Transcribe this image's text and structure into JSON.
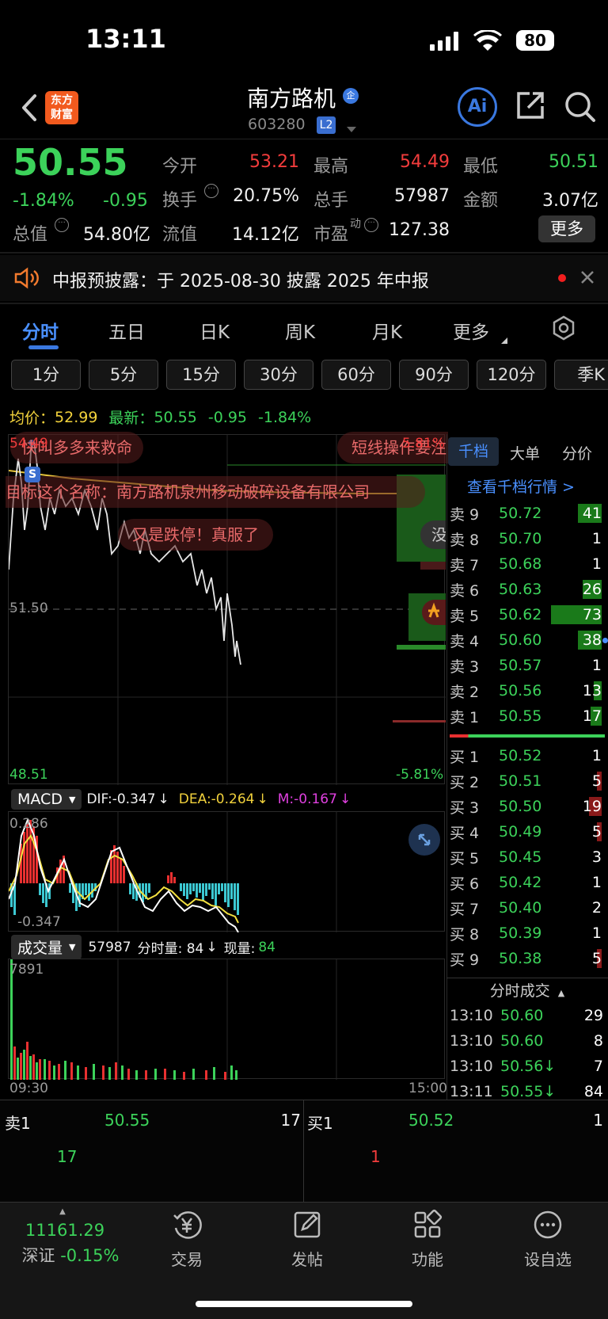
{
  "status": {
    "time": "13:11",
    "battery": "80"
  },
  "header": {
    "logo_line1": "东方",
    "logo_line2": "财富",
    "title": "南方路机",
    "title_badge": "企",
    "code": "603280",
    "level": "L2",
    "ai_label": "Ai"
  },
  "quote": {
    "price": "50.55",
    "change_pct": "-1.84%",
    "change": "-0.95",
    "open_label": "今开",
    "open": "53.21",
    "high_label": "最高",
    "high": "54.49",
    "low_label": "最低",
    "low": "50.51",
    "turnover_label": "换手",
    "turnover": "20.75%",
    "volume_label": "总手",
    "volume": "57987",
    "amount_label": "金额",
    "amount": "3.07亿",
    "mcap_label": "总值",
    "mcap": "54.80亿",
    "float_label": "流值",
    "float_cap": "14.12亿",
    "pe_label": "市盈",
    "pe_sup": "动",
    "pe": "127.38",
    "more": "更多"
  },
  "notice": {
    "text": "中报预披露：于 2025-08-30 披露 2025 年中报"
  },
  "tabs": [
    "分时",
    "五日",
    "日K",
    "周K",
    "月K",
    "更多"
  ],
  "periods": [
    "1分",
    "5分",
    "15分",
    "30分",
    "60分",
    "90分",
    "120分",
    "季K"
  ],
  "chart": {
    "avg_label": "均价：",
    "avg": "52.99",
    "last_label": "最新：",
    "last": "50.55",
    "last_chg": "-0.95",
    "last_pct": "-1.84%",
    "top_price": "54.49",
    "top_pct": "5.81%",
    "mid_price": "51.50",
    "bottom_price": "48.51",
    "bottom_pct": "-5.81%",
    "comments": [
      "快叫多多来救命",
      "短线操作要注",
      "目标这个名称：南方路机泉州移动破碎设备有限公司",
      "又是跌停！真服了",
      "没"
    ],
    "s_marker": "S"
  },
  "macd": {
    "selector": "MACD",
    "dif": "DIF:-0.347",
    "dea": "DEA:-0.264",
    "m": "M:-0.167",
    "top": "0.286",
    "bottom": "-0.347"
  },
  "vol": {
    "selector": "成交量",
    "total": "57987",
    "period_label": "分时量: 84",
    "now_label": "现量:",
    "now": "84",
    "top": "7891",
    "time_start": "09:30",
    "time_end": "15:00"
  },
  "orderbook": {
    "tabs": [
      "千档",
      "大单",
      "分价"
    ],
    "view_link": "查看千档行情 >",
    "asks": [
      {
        "label": "卖 9",
        "price": "50.72",
        "vol": "41"
      },
      {
        "label": "卖 8",
        "price": "50.70",
        "vol": "1"
      },
      {
        "label": "卖 7",
        "price": "50.68",
        "vol": "1"
      },
      {
        "label": "卖 6",
        "price": "50.63",
        "vol": "26"
      },
      {
        "label": "卖 5",
        "price": "50.62",
        "vol": "73"
      },
      {
        "label": "卖 4",
        "price": "50.60",
        "vol": "38"
      },
      {
        "label": "卖 3",
        "price": "50.57",
        "vol": "1"
      },
      {
        "label": "卖 2",
        "price": "50.56",
        "vol": "13"
      },
      {
        "label": "卖 1",
        "price": "50.55",
        "vol": "17"
      }
    ],
    "bids": [
      {
        "label": "买 1",
        "price": "50.52",
        "vol": "1"
      },
      {
        "label": "买 2",
        "price": "50.51",
        "vol": "5"
      },
      {
        "label": "买 3",
        "price": "50.50",
        "vol": "19"
      },
      {
        "label": "买 4",
        "price": "50.49",
        "vol": "5"
      },
      {
        "label": "买 5",
        "price": "50.45",
        "vol": "3"
      },
      {
        "label": "买 6",
        "price": "50.42",
        "vol": "1"
      },
      {
        "label": "买 7",
        "price": "50.40",
        "vol": "2"
      },
      {
        "label": "买 8",
        "price": "50.39",
        "vol": "1"
      },
      {
        "label": "买 9",
        "price": "50.38",
        "vol": "5"
      }
    ],
    "ticks_title": "分时成交",
    "ticks": [
      {
        "time": "13:10",
        "price": "50.60",
        "vol": "29"
      },
      {
        "time": "13:10",
        "price": "50.60",
        "vol": "8"
      },
      {
        "time": "13:10",
        "price": "50.56↓",
        "vol": "7"
      },
      {
        "time": "13:11",
        "price": "50.55↓",
        "vol": "84"
      }
    ]
  },
  "summary": {
    "ask_label": "卖1",
    "ask_price": "50.55",
    "ask_vol": "17",
    "ask_big": "17",
    "bid_label": "买1",
    "bid_price": "50.52",
    "bid_vol": "1",
    "bid_big": "1"
  },
  "nav": {
    "index_value": "11161.29",
    "index_name": "深证",
    "index_pct": "-0.15%",
    "items": [
      "交易",
      "发帖",
      "功能",
      "设自选"
    ]
  }
}
